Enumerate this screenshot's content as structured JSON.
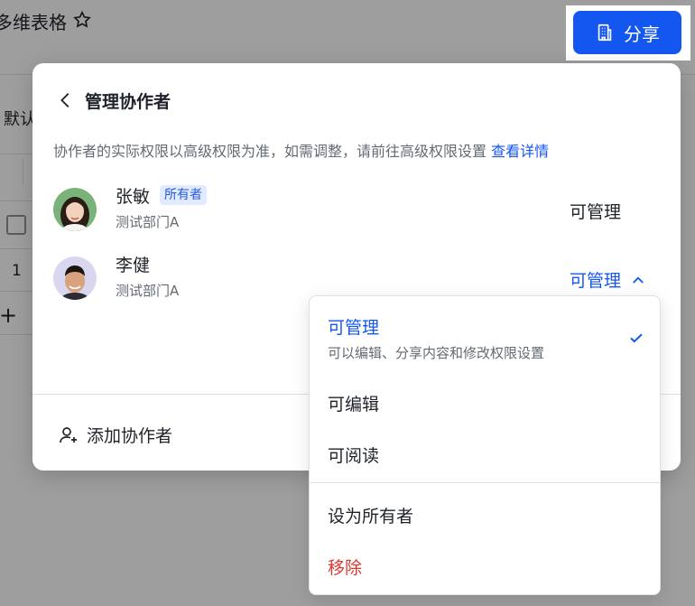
{
  "doc": {
    "title": "多维表格",
    "view_tab": "默认",
    "row_number": "1"
  },
  "share": {
    "label": "分享",
    "icon": "building-icon",
    "color": "#1456f0"
  },
  "panel": {
    "title": "管理协作者",
    "notice": "协作者的实际权限以高级权限为准，如需调整，请前往高级权限设置",
    "notice_link": "查看详情",
    "members": [
      {
        "name": "张敏",
        "badge": "所有者",
        "dept": "测试部门A",
        "permission": "可管理"
      },
      {
        "name": "李健",
        "dept": "测试部门A",
        "permission": "可管理"
      }
    ],
    "add_label": "添加协作者"
  },
  "menu": {
    "items": [
      {
        "label": "可管理",
        "desc": "可以编辑、分享内容和修改权限设置",
        "selected": true
      },
      {
        "label": "可编辑"
      },
      {
        "label": "可阅读"
      },
      {
        "label": "设为所有者"
      },
      {
        "label": "移除",
        "danger": true
      }
    ],
    "accent": "#1456f0",
    "danger_color": "#d83931"
  }
}
